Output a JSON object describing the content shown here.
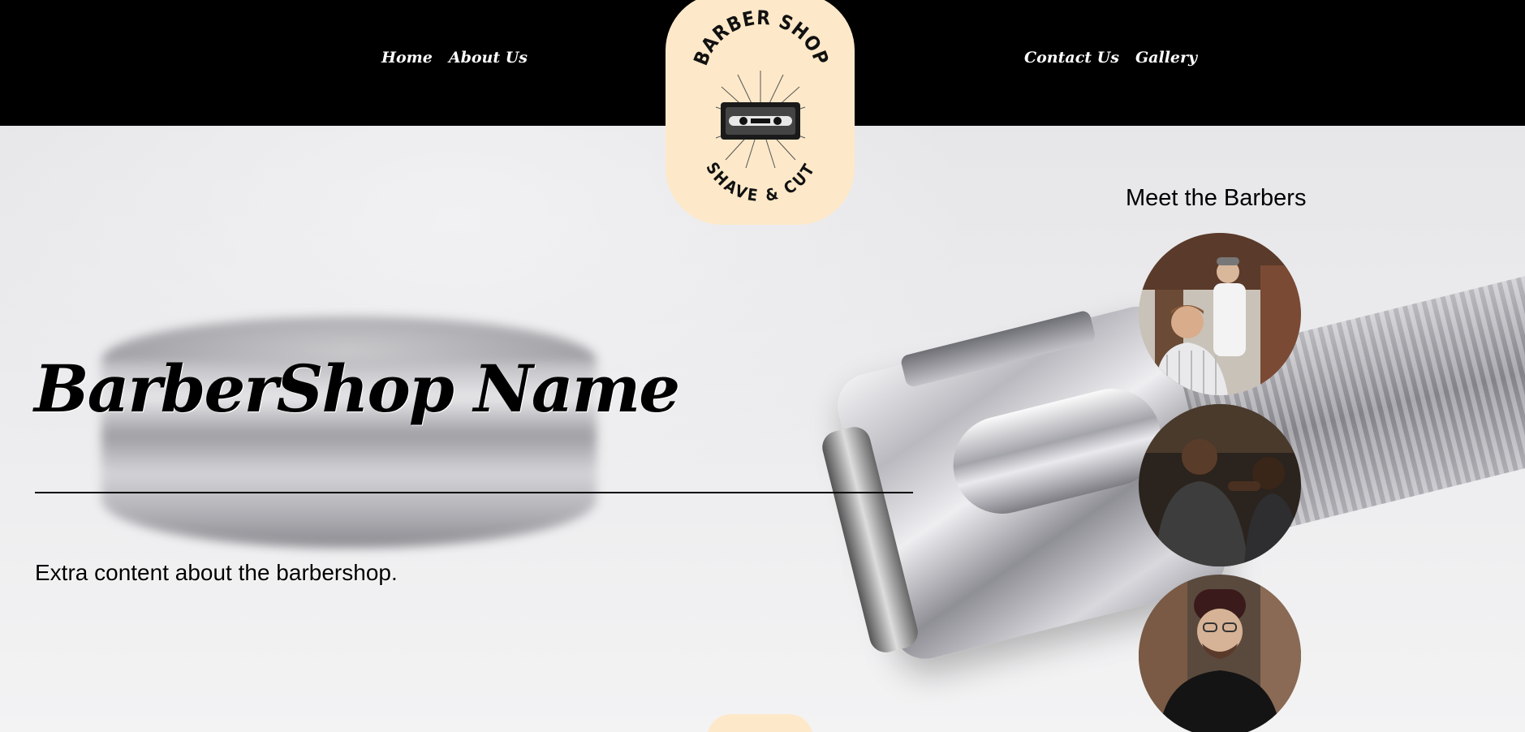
{
  "nav": {
    "left": [
      {
        "label": "Home"
      },
      {
        "label": "About Us"
      }
    ],
    "right": [
      {
        "label": "Contact Us"
      },
      {
        "label": "Gallery"
      }
    ]
  },
  "logo": {
    "top_text": "BARBER SHOP",
    "bottom_text": "SHAVE & CUT"
  },
  "hero": {
    "title": "BarberShop Name",
    "extra": "Extra content about the barbershop."
  },
  "barbers": {
    "heading": "Meet the Barbers",
    "photos": [
      {
        "icon": "barber-photo-1"
      },
      {
        "icon": "barber-photo-2"
      },
      {
        "icon": "barber-photo-3"
      }
    ]
  },
  "colors": {
    "header_bg": "#000000",
    "badge_bg": "#fde9c9",
    "text": "#000000"
  }
}
